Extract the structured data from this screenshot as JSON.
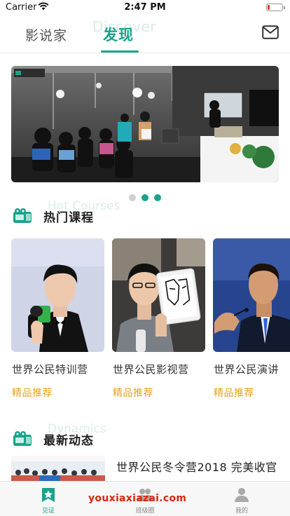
{
  "status_bar": {
    "carrier": "Carrier",
    "time": "2:47 PM",
    "battery_level": 0.15
  },
  "top_nav": {
    "tab_left": "影说家",
    "tab_active": "发现",
    "tab_active_watermark": "Discover",
    "mail_icon": "mail-icon"
  },
  "banner": {
    "page_count": 3,
    "active_page": 2
  },
  "hot_courses": {
    "title": "热门课程",
    "watermark": "Hot Courses",
    "icon": "camera-icon",
    "items": [
      {
        "title": "世界公民特训营",
        "tag": "精品推荐"
      },
      {
        "title": "世界公民影视营",
        "tag": "精品推荐"
      },
      {
        "title": "世界公民演讲",
        "tag": "精品推荐"
      }
    ]
  },
  "dynamics": {
    "title": "最新动态",
    "watermark": "Dynamics",
    "icon": "camera-icon",
    "items": [
      {
        "title": "世界公民冬令营2018 完美收官"
      }
    ]
  },
  "tabbar": {
    "items": [
      {
        "label": "见证",
        "icon": "star-badge-icon",
        "active": true
      },
      {
        "label": "班级圈",
        "icon": "group-icon",
        "active": false
      },
      {
        "label": "我的",
        "icon": "person-icon",
        "active": false
      }
    ]
  },
  "site_watermark": "youxiaxiazai.com",
  "colors": {
    "accent": "#1aa38b",
    "tag": "#e8a21b",
    "watermark": "#d9250f"
  }
}
